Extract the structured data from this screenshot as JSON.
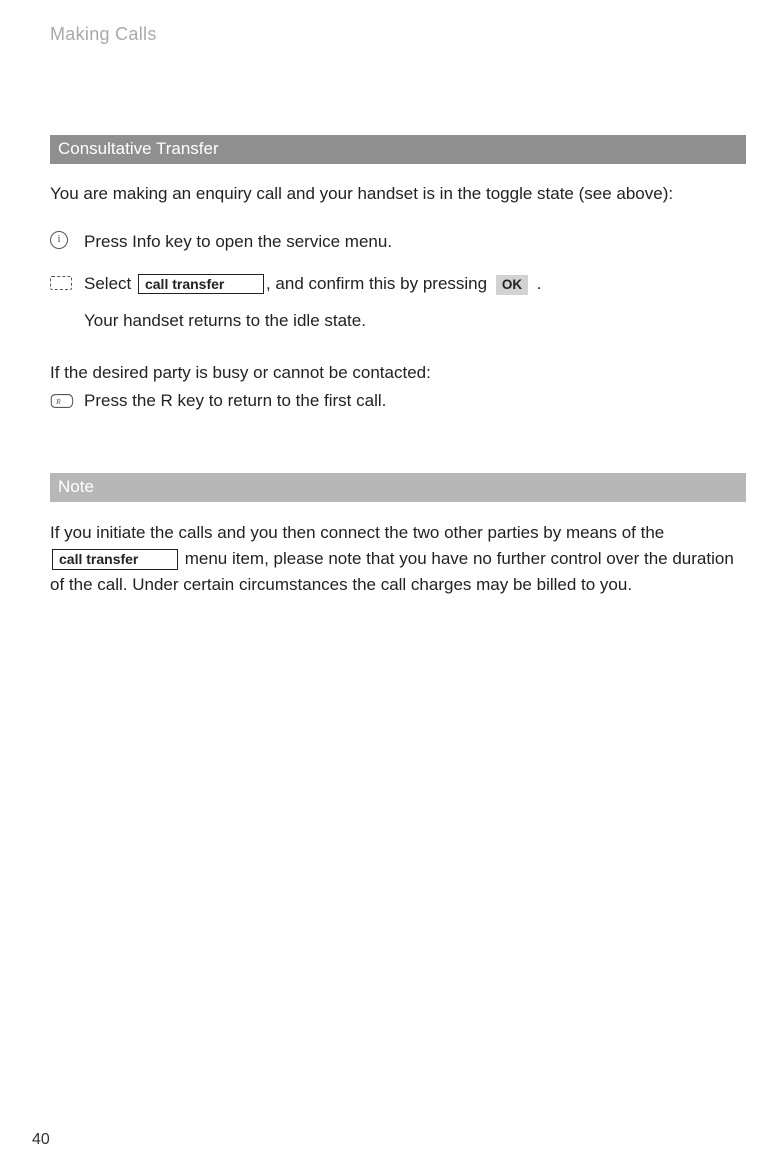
{
  "header": {
    "title": "Making Calls"
  },
  "section1": {
    "heading": "Consultative Transfer",
    "intro": "You are making an enquiry call and your handset is in the toggle state (see above):",
    "step1": "Press Info key to open the service menu.",
    "step2_pre": "Select ",
    "step2_menu": "call transfer",
    "step2_mid": ",  and confirm this by pressing ",
    "step2_ok": "OK",
    "step2_post": " .",
    "step2_result": "Your handset returns to the idle state.",
    "busy_intro": "If the desired party is busy or cannot be contacted:",
    "busy_step": "Press the R key to return to the first call."
  },
  "section2": {
    "heading": "Note",
    "line1": "If you initiate the calls and you then connect the two other parties by means of the",
    "menu": "call transfer",
    "line2": " menu item, please note that you have no further control over the duration of the call. Under certain circumstances the call charges may be billed to you."
  },
  "page_number": "40"
}
